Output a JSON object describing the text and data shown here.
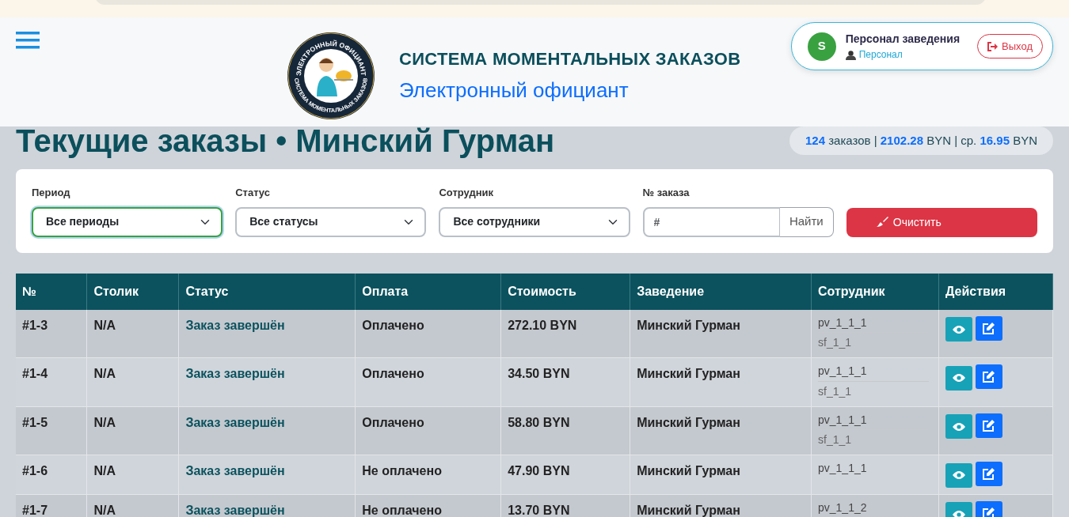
{
  "header": {
    "title": "СИСТЕМА МОМЕНТАЛЬНЫХ ЗАКАЗОВ",
    "subtitle": "Электронный официант",
    "logo_top": "ЭЛЕКТРОННЫЙ ОФИЦИАНТ",
    "logo_bottom": "СИСТЕМА МОМЕНТАЛЬНЫХ ЗАКАЗОВ"
  },
  "user": {
    "avatar": "S",
    "name": "Персонал заведения",
    "role": "Персонал",
    "logout": "Выход"
  },
  "page_title": "Текущие заказы • Минский Гурман",
  "stats": "**124** заказов | **2102.28** BYN | ср. **16.95** BYN",
  "filters": [
    {
      "kind": "select",
      "label": "Период",
      "value": "Все периоды",
      "focused": true
    },
    {
      "kind": "select",
      "label": "Статус",
      "value": "Все статусы",
      "focused": false
    },
    {
      "kind": "select",
      "label": "Сотрудник",
      "value": "Все сотрудники",
      "focused": false
    },
    {
      "kind": "search",
      "label": "№ заказа",
      "placeholder": "#",
      "button": "Найти"
    }
  ],
  "clear_button": "Очистить",
  "table": {
    "columns": [
      "№",
      "Столик",
      "Статус",
      "Оплата",
      "Стоимость",
      "Заведение",
      "Сотрудник",
      "Действия"
    ],
    "rows": [
      {
        "number": "#1-3",
        "table": "N/A",
        "status": "Заказ завершён",
        "payment": "Оплачено",
        "cost": "272.10 BYN",
        "venue": "Минский Гурман",
        "staff": [
          "pv_1_1_1",
          "sf_1_1"
        ]
      },
      {
        "number": "#1-4",
        "table": "N/A",
        "status": "Заказ завершён",
        "payment": "Оплачено",
        "cost": "34.50 BYN",
        "venue": "Минский Гурман",
        "staff": [
          "pv_1_1_1",
          "sf_1_1"
        ]
      },
      {
        "number": "#1-5",
        "table": "N/A",
        "status": "Заказ завершён",
        "payment": "Оплачено",
        "cost": "58.80 BYN",
        "venue": "Минский Гурман",
        "staff": [
          "pv_1_1_1",
          "sf_1_1"
        ]
      },
      {
        "number": "#1-6",
        "table": "N/A",
        "status": "Заказ завершён",
        "payment": "Не оплачено",
        "cost": "47.90 BYN",
        "venue": "Минский Гурман",
        "staff": [
          "pv_1_1_1"
        ]
      },
      {
        "number": "#1-7",
        "table": "N/A",
        "status": "Заказ завершён",
        "payment": "Не оплачено",
        "cost": "13.70 BYN",
        "venue": "Минский Гурман",
        "staff": [
          "pv_1_1_2"
        ]
      }
    ]
  }
}
